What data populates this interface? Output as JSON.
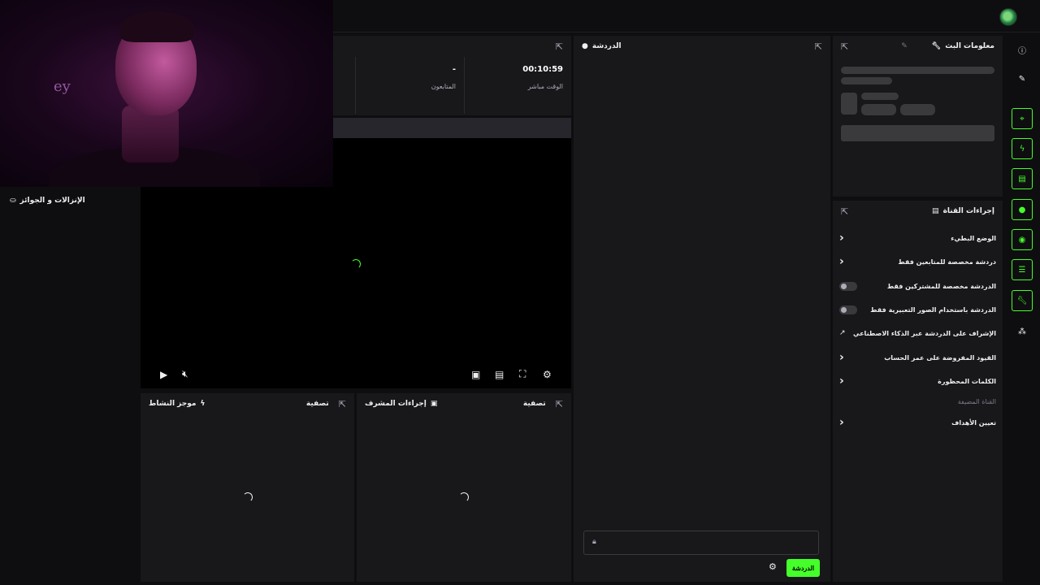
{
  "topbar": {
    "avatar": "user-avatar"
  },
  "stats": [
    {
      "value": "00:10:59",
      "label": "الوقت مباشر"
    },
    {
      "value": "-",
      "label": "المتابعون"
    }
  ],
  "chat": {
    "title": "الدردشة",
    "send_label": "الدردشة",
    "input_placeholder": ""
  },
  "stream_info": {
    "title": "معلومات البث"
  },
  "channel_actions": {
    "title": "إجراءات القناة",
    "items": [
      {
        "label": "الوضع البطيء",
        "control": "chevron"
      },
      {
        "label": "دردشة مخصصة للمتابعين فقط",
        "control": "chevron"
      },
      {
        "label": "الدردشة مخصصة للمشتركين فقط",
        "control": "toggle"
      },
      {
        "label": "الدردشة باستخدام الصور التعبيرية فقط",
        "control": "toggle"
      },
      {
        "label": "الإشراف على الدردشة عبر الذكاء الاصطناعي",
        "control": "external"
      },
      {
        "label": "القيود المفروضة على عمر الحساب",
        "control": "chevron"
      },
      {
        "label": "الكلمات المحظورة",
        "control": "chevron"
      }
    ],
    "section_header": "القناة المضيفة",
    "section_items": [
      {
        "label": "تعيين الأهداف",
        "control": "chevron"
      }
    ]
  },
  "activity_feed": {
    "title": "موجز النشاط",
    "filter": "تصفية"
  },
  "mod_actions": {
    "title": "إجراءات المشرف",
    "filter": "تصفية"
  },
  "rewards": {
    "title": "الإنزالات و الجوائز"
  },
  "colors": {
    "accent": "#45ff2a",
    "panel": "#18181b",
    "background": "#0e0e10"
  }
}
